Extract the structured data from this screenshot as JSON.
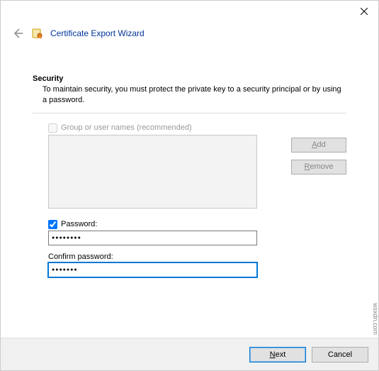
{
  "window": {
    "close_tooltip": "Close"
  },
  "header": {
    "title": "Certificate Export Wizard"
  },
  "security": {
    "heading": "Security",
    "description": "To maintain security, you must protect the private key to a security principal or by using a password."
  },
  "group": {
    "checkbox_label": "Group or user names (recommended)",
    "checked": false,
    "add_label": "Add",
    "remove_label": "Remove"
  },
  "password": {
    "checkbox_label": "Password:",
    "checked": true,
    "value": "●●●●●●●●",
    "confirm_label": "Confirm password:",
    "confirm_value": "●●●●●●●"
  },
  "footer": {
    "next_label": "Next",
    "cancel_label": "Cancel"
  },
  "watermark": "wsxdn.com"
}
